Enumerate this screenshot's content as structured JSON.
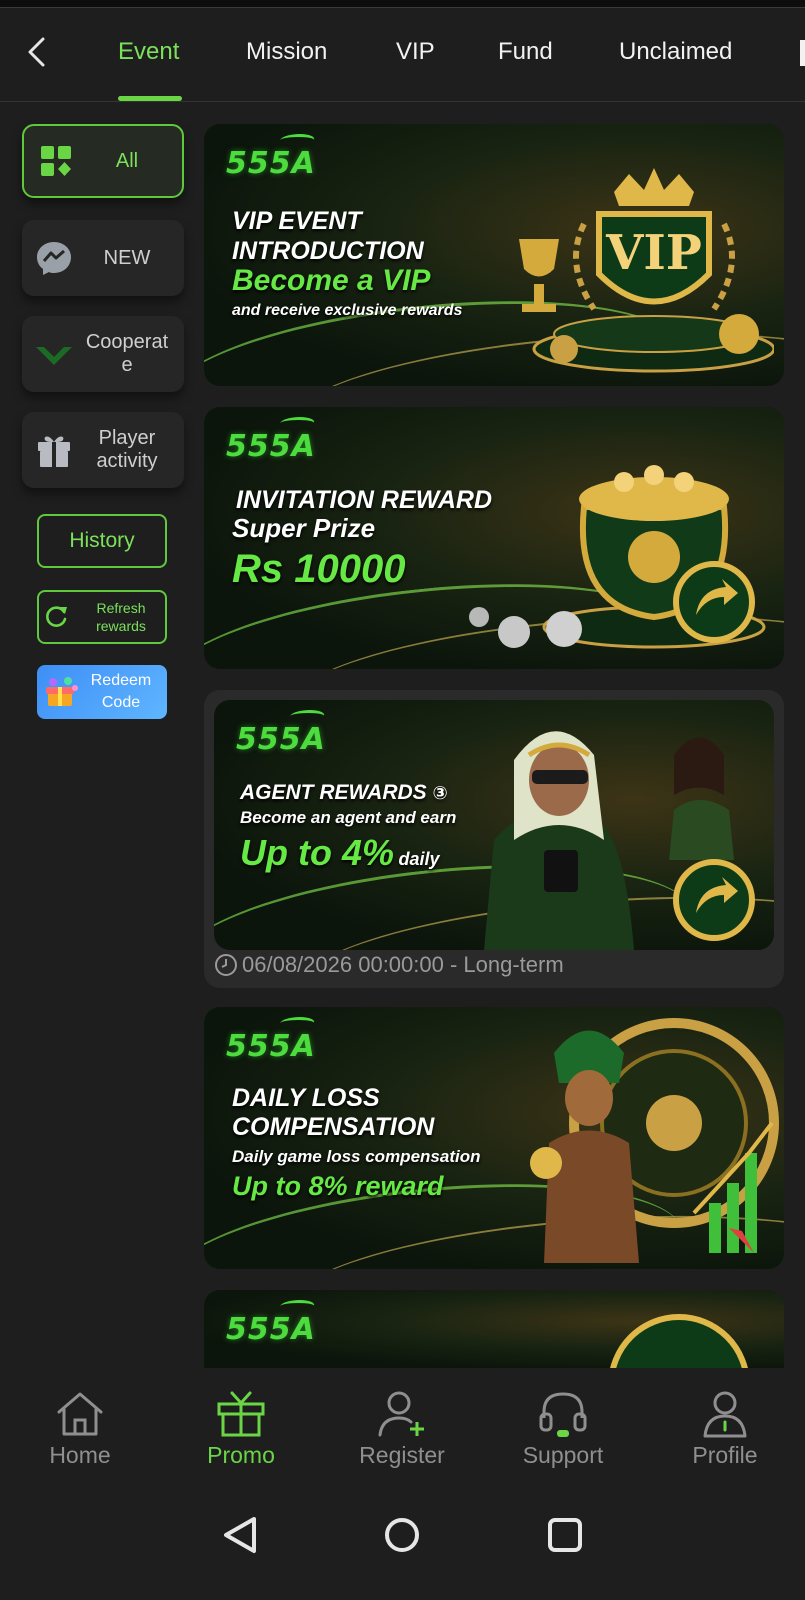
{
  "header": {
    "tabs": [
      {
        "label": "Event",
        "active": true
      },
      {
        "label": "Mission"
      },
      {
        "label": "VIP"
      },
      {
        "label": "Fund"
      },
      {
        "label": "Unclaimed"
      }
    ]
  },
  "sidebar": {
    "items": [
      {
        "label": "All",
        "icon": "grid-apps-icon",
        "active": true
      },
      {
        "label": "NEW",
        "icon": "messenger-icon"
      },
      {
        "label": "Cooperat\ne",
        "icon": "green-chevron-icon"
      },
      {
        "label": "Player\nactivity",
        "icon": "gift-box-icon"
      }
    ],
    "history_label": "History",
    "refresh_label": "Refresh\nrewards",
    "redeem_label": "Redeem\nCode"
  },
  "banners": [
    {
      "logo": "555A",
      "line1": "VIP EVENT",
      "line2": "INTRODUCTION",
      "line3": "Become a VIP",
      "line4": "and receive exclusive rewards"
    },
    {
      "logo": "555A",
      "line1": "INVITATION REWARD",
      "line2": "Super Prize",
      "line3": "Rs 10000"
    },
    {
      "logo": "555A",
      "line1": "AGENT REWARDS",
      "line1_badge": "③",
      "line2": "Become an agent and earn",
      "line3": "Up to 4%",
      "line3_suffix": "daily",
      "date": "06/08/2026 00:00:00 - Long-term"
    },
    {
      "logo": "555A",
      "line1": "DAILY LOSS",
      "line2": "COMPENSATION",
      "line3": "Daily game loss compensation",
      "line4": "Up to 8% reward"
    },
    {
      "logo": "555A"
    }
  ],
  "bottom_nav": [
    {
      "label": "Home",
      "icon": "home-icon"
    },
    {
      "label": "Promo",
      "icon": "gift-icon",
      "active": true
    },
    {
      "label": "Register",
      "icon": "add-user-icon"
    },
    {
      "label": "Support",
      "icon": "headset-icon"
    },
    {
      "label": "Profile",
      "icon": "profile-icon"
    }
  ],
  "colors": {
    "accent": "#6ad646",
    "background": "#1e1e1e",
    "card": "#262626",
    "gold": "#d4aa3c"
  }
}
